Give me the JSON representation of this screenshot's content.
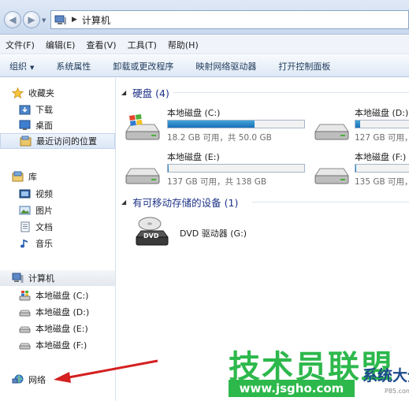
{
  "address_bar": {
    "path_label": "计算机"
  },
  "menu": [
    "文件(F)",
    "编辑(E)",
    "查看(V)",
    "工具(T)",
    "帮助(H)"
  ],
  "toolbar": {
    "organize": "组织",
    "items": [
      "系统属性",
      "卸载或更改程序",
      "映射网络驱动器",
      "打开控制面板"
    ]
  },
  "nav": {
    "favorites": {
      "label": "收藏夹",
      "items": [
        "下载",
        "桌面",
        "最近访问的位置"
      ]
    },
    "libraries": {
      "label": "库",
      "items": [
        "视频",
        "图片",
        "文档",
        "音乐"
      ]
    },
    "computer": {
      "label": "计算机",
      "items": [
        "本地磁盘 (C:)",
        "本地磁盘 (D:)",
        "本地磁盘 (E:)",
        "本地磁盘 (F:)"
      ]
    },
    "network": {
      "label": "网络"
    }
  },
  "content": {
    "hard_disks_header": "硬盘 (4)",
    "removable_header": "有可移动存储的设备 (1)",
    "drives": [
      {
        "name": "本地磁盘 (C:)",
        "free": "18.2 GB 可用，共 50.0 GB",
        "used_fraction": 0.636
      },
      {
        "name": "本地磁盘 (D:)",
        "free": "127 GB 可用，",
        "used_fraction": 0.08
      },
      {
        "name": "本地磁盘 (E:)",
        "free": "137 GB 可用，共 138 GB",
        "used_fraction": 0.007
      },
      {
        "name": "本地磁盘 (F:)",
        "free": "135 GB 可用，",
        "used_fraction": 0.01
      }
    ],
    "dvd": {
      "name": "DVD 驱动器 (G:)",
      "badge": "DVD"
    }
  },
  "watermark": {
    "main": "技术员联盟",
    "url": "www.jsgho.com",
    "sub": "系统大全",
    "small": "P85.com"
  },
  "colors": {
    "accent": "#1e3287",
    "bar_fill": "#1a70b6",
    "watermark_green": "#2db84c",
    "arrow_red": "#d42020"
  }
}
